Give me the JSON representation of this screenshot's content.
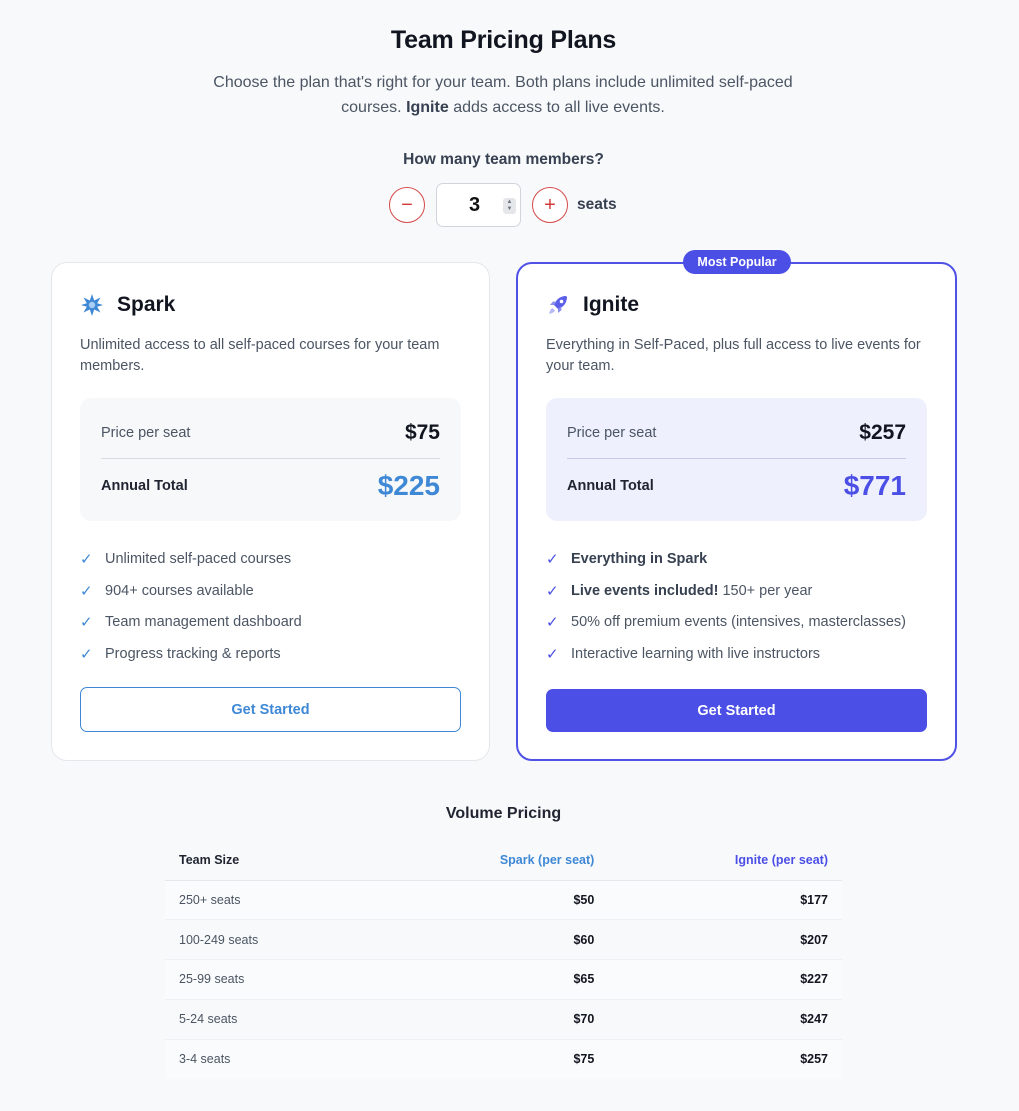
{
  "header": {
    "title": "Team Pricing Plans",
    "subtitle_pre": "Choose the plan that's right for your team. Both plans include unlimited self-paced courses.",
    "subtitle_bold": "Ignite",
    "subtitle_post": "adds access to all live events."
  },
  "seats": {
    "question": "How many team members?",
    "value": "3",
    "decrement_symbol": "−",
    "increment_symbol": "+",
    "unit_label": "seats"
  },
  "plans": {
    "spark": {
      "name": "Spark",
      "icon": "spark-icon",
      "description": "Unlimited access to all self-paced courses for your team members.",
      "price_label": "Price per seat",
      "price": "$75",
      "total_label": "Annual Total",
      "total": "$225",
      "features": [
        {
          "bold": "",
          "text": "Unlimited self-paced courses"
        },
        {
          "bold": "",
          "text": "904+ courses available"
        },
        {
          "bold": "",
          "text": "Team management dashboard"
        },
        {
          "bold": "",
          "text": "Progress tracking & reports"
        }
      ],
      "cta": "Get Started",
      "accent": "#3f88d6"
    },
    "ignite": {
      "badge": "Most Popular",
      "name": "Ignite",
      "icon": "rocket-icon",
      "description": "Everything in Self-Paced, plus full access to live events for your team.",
      "price_label": "Price per seat",
      "price": "$257",
      "total_label": "Annual Total",
      "total": "$771",
      "features": [
        {
          "bold": "Everything in Spark",
          "text": ""
        },
        {
          "bold": "Live events included!",
          "text": "150+ per year"
        },
        {
          "bold": "",
          "text": "50% off premium events (intensives, masterclasses)"
        },
        {
          "bold": "",
          "text": "Interactive learning with live instructors"
        }
      ],
      "cta": "Get Started",
      "accent": "#4b4fe6"
    }
  },
  "volume": {
    "title": "Volume Pricing",
    "headers": [
      "Team Size",
      "Spark (per seat)",
      "Ignite (per seat)"
    ],
    "rows": [
      [
        "250+ seats",
        "$50",
        "$177"
      ],
      [
        "100-249 seats",
        "$60",
        "$207"
      ],
      [
        "25-99 seats",
        "$65",
        "$227"
      ],
      [
        "5-24 seats",
        "$70",
        "$247"
      ],
      [
        "3-4 seats",
        "$75",
        "$257"
      ]
    ]
  }
}
